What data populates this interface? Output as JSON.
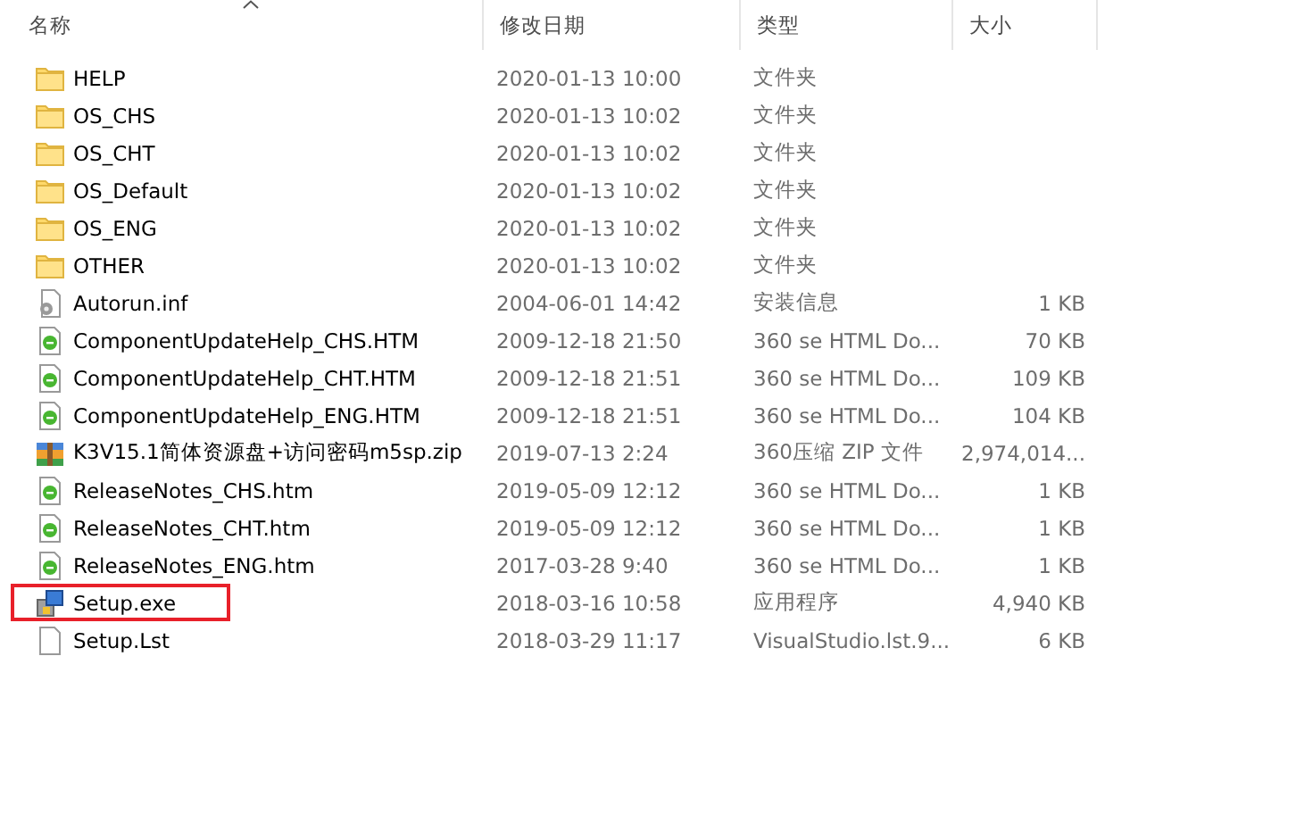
{
  "columns": [
    {
      "label": "名称",
      "sorted": true
    },
    {
      "label": "修改日期",
      "sorted": false
    },
    {
      "label": "类型",
      "sorted": false
    },
    {
      "label": "大小",
      "sorted": false
    }
  ],
  "rows": [
    {
      "kind": "folder",
      "name": "HELP",
      "date": "2020-01-13 10:00",
      "type": "文件夹",
      "highlighted": false
    },
    {
      "kind": "folder",
      "name": "OS_CHS",
      "date": "2020-01-13 10:02",
      "type": "文件夹",
      "highlighted": false
    },
    {
      "kind": "folder",
      "name": "OS_CHT",
      "date": "2020-01-13 10:02",
      "type": "文件夹",
      "highlighted": false
    },
    {
      "kind": "folder",
      "name": "OS_Default",
      "date": "2020-01-13 10:02",
      "type": "文件夹",
      "highlighted": false
    },
    {
      "kind": "folder",
      "name": "OS_ENG",
      "date": "2020-01-13 10:02",
      "type": "文件夹",
      "highlighted": false
    },
    {
      "kind": "folder",
      "name": "OTHER",
      "date": "2020-01-13 10:02",
      "type": "文件夹",
      "highlighted": false
    },
    {
      "kind": "settings",
      "name": "Autorun.inf",
      "date": "2004-06-01 14:42",
      "type": "安装信息",
      "size": "1 KB",
      "highlighted": false
    },
    {
      "kind": "html",
      "name": "ComponentUpdateHelp_CHS.HTM",
      "date": "2009-12-18 21:50",
      "type": "360 se HTML Do...",
      "size": "70 KB",
      "highlighted": false
    },
    {
      "kind": "html",
      "name": "ComponentUpdateHelp_CHT.HTM",
      "date": "2009-12-18 21:51",
      "type": "360 se HTML Do...",
      "size": "109 KB",
      "highlighted": false
    },
    {
      "kind": "html",
      "name": "ComponentUpdateHelp_ENG.HTM",
      "date": "2009-12-18 21:51",
      "type": "360 se HTML Do...",
      "size": "104 KB",
      "highlighted": false
    },
    {
      "kind": "archive",
      "name": "K3V15.1简体资源盘+访问密码m5sp.zip",
      "date": "2019-07-13 2:24",
      "type": "360压缩 ZIP 文件",
      "size": "2,974,014...",
      "highlighted": false
    },
    {
      "kind": "html",
      "name": "ReleaseNotes_CHS.htm",
      "date": "2019-05-09 12:12",
      "type": "360 se HTML Do...",
      "size": "1 KB",
      "highlighted": false
    },
    {
      "kind": "html",
      "name": "ReleaseNotes_CHT.htm",
      "date": "2019-05-09 12:12",
      "type": "360 se HTML Do...",
      "size": "1 KB",
      "highlighted": false
    },
    {
      "kind": "html",
      "name": "ReleaseNotes_ENG.htm",
      "date": "2017-03-28 9:40",
      "type": "360 se HTML Do...",
      "size": "1 KB",
      "highlighted": false
    },
    {
      "kind": "installer",
      "name": "Setup.exe",
      "date": "2018-03-16 10:58",
      "type": "应用程序",
      "size": "4,940 KB",
      "highlighted": true
    },
    {
      "kind": "file",
      "name": "Setup.Lst",
      "date": "2018-03-29 11:17",
      "type": "VisualStudio.lst.9...",
      "size": "6 KB",
      "highlighted": false
    }
  ]
}
